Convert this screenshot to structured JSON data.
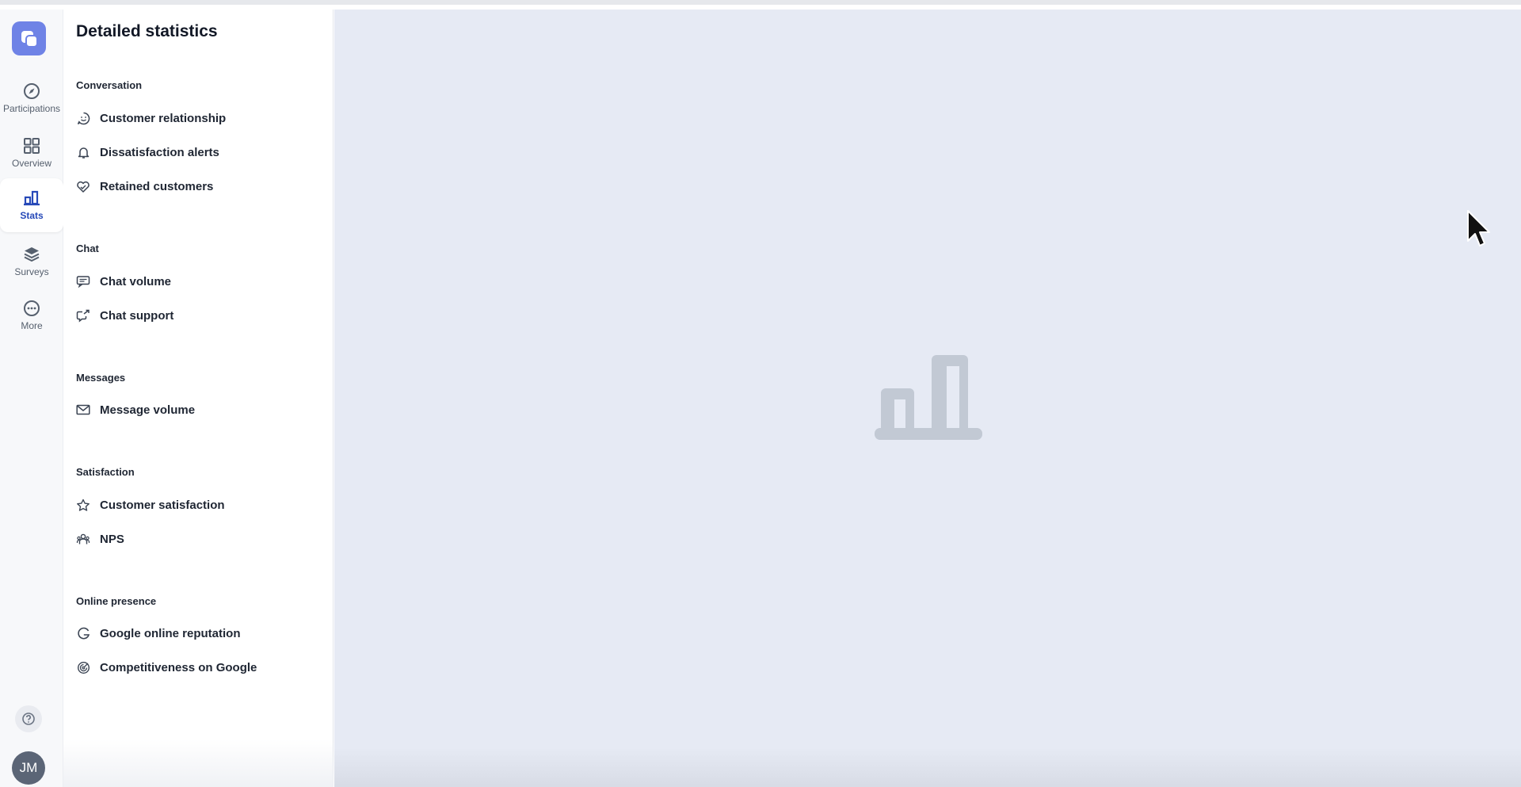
{
  "nav": {
    "title": "Detailed statistics",
    "sections": [
      {
        "title": "Conversation",
        "items": [
          {
            "label": "Customer relationship",
            "icon": "smiley-icon"
          },
          {
            "label": "Dissatisfaction alerts",
            "icon": "bell-icon"
          },
          {
            "label": "Retained customers",
            "icon": "heart-icon"
          }
        ]
      },
      {
        "title": "Chat",
        "items": [
          {
            "label": "Chat volume",
            "icon": "chat-bubble-icon"
          },
          {
            "label": "Chat support",
            "icon": "chat-share-icon"
          }
        ]
      },
      {
        "title": "Messages",
        "items": [
          {
            "label": "Message volume",
            "icon": "envelope-icon"
          }
        ]
      },
      {
        "title": "Satisfaction",
        "items": [
          {
            "label": "Customer satisfaction",
            "icon": "star-icon"
          },
          {
            "label": "NPS",
            "icon": "users-icon"
          }
        ]
      },
      {
        "title": "Online presence",
        "items": [
          {
            "label": "Google online reputation",
            "icon": "google-icon"
          },
          {
            "label": "Competitiveness on Google",
            "icon": "radar-icon"
          }
        ]
      }
    ]
  },
  "rail": {
    "items": [
      {
        "label": "Participations",
        "icon": "compass-icon"
      },
      {
        "label": "Overview",
        "icon": "grid-icon"
      },
      {
        "label": "Stats",
        "icon": "bar-chart-icon",
        "active": true
      },
      {
        "label": "Surveys",
        "icon": "layers-icon"
      },
      {
        "label": "More",
        "icon": "more-dots-icon"
      }
    ],
    "avatar_initials": "JM"
  },
  "colors": {
    "accent": "#2749b8",
    "logo": "#6f83e6",
    "main_bg": "#e6eaf4",
    "placeholder_icon": "#c2c9d4"
  }
}
